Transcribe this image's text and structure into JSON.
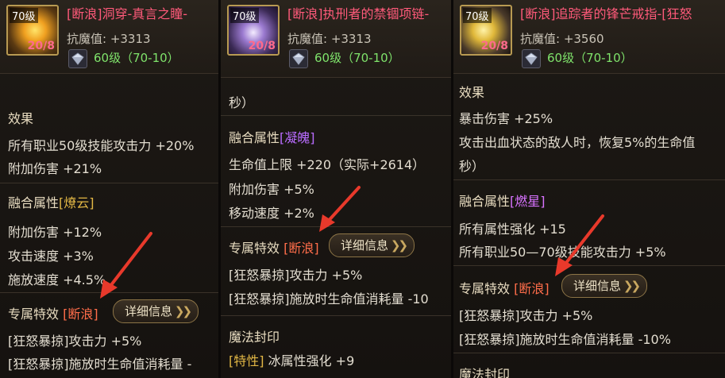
{
  "panel1": {
    "level": "70级",
    "stack": "20/8",
    "tag": "[断浪]",
    "name": "洞穿-真言之瞳-",
    "resist": "抗魔值: +3313",
    "rank": "60级（70-10）",
    "effect_title": "效果",
    "effect_lines": [
      "所有职业50级技能攻击力 +20%",
      "附加伤害 +21%"
    ],
    "fusion_label": "融合属性",
    "fusion_tag": "[燎云]",
    "fusion_lines": [
      "附加伤害 +12%",
      "攻击速度 +3%",
      "施放速度 +4.5%"
    ],
    "special_label": "专属特效",
    "special_tag": "[断浪]",
    "detail_btn": "详细信息",
    "special_lines": [
      "[狂怒暴掠]攻击力 +5%",
      "[狂怒暴掠]施放时生命值消耗量 -"
    ]
  },
  "panel2": {
    "level": "70级",
    "stack": "20/8",
    "tag": "[断浪]",
    "name": "执刑者的禁锢项链-",
    "resist": "抗魔值: +3313",
    "rank": "60级（70-10）",
    "cont": "秒）",
    "fusion_label": "融合属性",
    "fusion_tag": "[凝魄]",
    "fusion_lines": [
      "生命值上限 +220（实际+2614）",
      "附加伤害 +5%",
      "移动速度 +2%"
    ],
    "special_label": "专属特效",
    "special_tag": "[断浪]",
    "detail_btn": "详细信息",
    "special_lines": [
      "[狂怒暴掠]攻击力 +5%",
      "[狂怒暴掠]施放时生命值消耗量 -10"
    ],
    "seal_title": "魔法封印",
    "seal_tag": "[特性]",
    "seal_text": " 冰属性强化 +9"
  },
  "panel3": {
    "level": "70级",
    "stack": "20/8",
    "tag": "[断浪]",
    "name": "追踪者的锋芒戒指-[狂怒",
    "resist": "抗魔值: +3560",
    "rank": "60级（70-10）",
    "effect_title": "效果",
    "effect_lines": [
      "暴击伤害 +25%",
      "攻击出血状态的敌人时，恢复5%的生命值",
      "秒）"
    ],
    "fusion_label": "融合属性",
    "fusion_tag": "[燃星]",
    "fusion_lines": [
      "所有属性强化 +15",
      "所有职业50—70级技能攻击力 +5%"
    ],
    "special_label": "专属特效",
    "special_tag": "[断浪]",
    "detail_btn": "详细信息",
    "special_lines": [
      "[狂怒暴掠]攻击力 +5%",
      "[狂怒暴掠]施放时生命值消耗量 -10%"
    ],
    "seal_title": "魔法封印"
  },
  "colors": {
    "tag_red": "#ff5a7a",
    "green": "#7fe36b",
    "gold": "#e2b745",
    "purple": "#b96cff",
    "orange": "#ff6d4a",
    "annotation_red": "#e8392b"
  },
  "icons": [
    "item-icon-eye",
    "item-icon-necklace",
    "item-icon-ring",
    "diamond-icon",
    "double-chevron-icon",
    "annotation-arrow"
  ]
}
